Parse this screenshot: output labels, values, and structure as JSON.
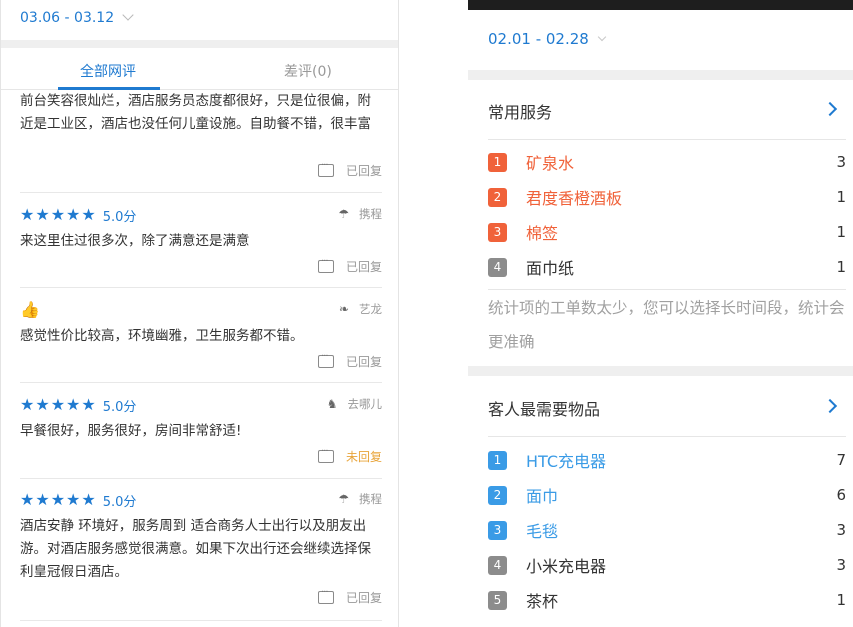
{
  "left": {
    "date_range": "03.06 - 03.12",
    "tabs": [
      {
        "label": "全部网评",
        "active": true
      },
      {
        "label": "差评(0)",
        "active": false
      }
    ],
    "reviews": [
      {
        "text": "前台笑容很灿烂，酒店服务员态度都很好，只是位很偏，附近是工业区，酒店也没任何儿童设施。自助餐不错，很丰富",
        "reply_status": "已回复",
        "replied": true
      },
      {
        "rating_type": "stars",
        "stars": 5,
        "score": "5.0分",
        "source": "携程",
        "text": "来这里住过很多次，除了满意还是满意",
        "reply_status": "已回复",
        "replied": true
      },
      {
        "rating_type": "thumb",
        "source": "艺龙",
        "text": "感觉性价比较高，环境幽雅，卫生服务都不错。",
        "reply_status": "已回复",
        "replied": true
      },
      {
        "rating_type": "stars",
        "stars": 5,
        "score": "5.0分",
        "source": "去哪儿",
        "text": "早餐很好，服务很好，房间非常舒适!",
        "reply_status": "未回复",
        "replied": false
      },
      {
        "rating_type": "stars",
        "stars": 5,
        "score": "5.0分",
        "source": "携程",
        "text": "酒店安静 环境好，服务周到 适合商务人士出行以及朋友出游。对酒店服务感觉很满意。如果下次出行还会继续选择保利皇冠假日酒店。",
        "reply_status": "已回复",
        "replied": true
      }
    ]
  },
  "right": {
    "date_range": "02.01 - 02.28",
    "common_services": {
      "title": "常用服务",
      "items": [
        {
          "rank": "1",
          "name": "矿泉水",
          "count": "3",
          "highlight": true
        },
        {
          "rank": "2",
          "name": "君度香橙酒板",
          "count": "1",
          "highlight": true
        },
        {
          "rank": "3",
          "name": "棉签",
          "count": "1",
          "highlight": true
        },
        {
          "rank": "4",
          "name": "面巾纸",
          "count": "1",
          "highlight": false
        }
      ],
      "note": "统计项的工单数太少，您可以选择长时间段，统计会更准确"
    },
    "guest_needs": {
      "title": "客人最需要物品",
      "items": [
        {
          "rank": "1",
          "name": "HTC充电器",
          "count": "7",
          "highlight": true
        },
        {
          "rank": "2",
          "name": "面巾",
          "count": "6",
          "highlight": true
        },
        {
          "rank": "3",
          "name": "毛毯",
          "count": "3",
          "highlight": true
        },
        {
          "rank": "4",
          "name": "小米充电器",
          "count": "3",
          "highlight": false
        },
        {
          "rank": "5",
          "name": "茶杯",
          "count": "1",
          "highlight": false
        }
      ]
    }
  },
  "colors": {
    "accent_blue": "#1f7ad0",
    "service_orange": "#f0623a",
    "need_blue": "#3a9be6",
    "gray_badge": "#8c8c8c",
    "pending": "#e8a43a"
  },
  "icons": {
    "reply": "comment-dots-icon",
    "star": "star-icon",
    "thumb": "thumbs-up-icon",
    "chevron": "chevron-right-icon"
  }
}
